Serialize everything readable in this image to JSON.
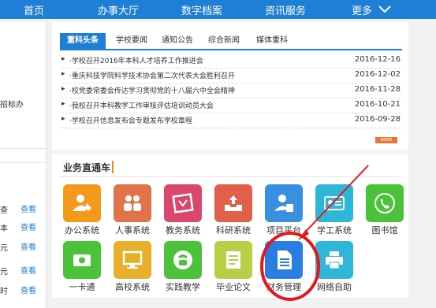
{
  "nav": {
    "items": [
      "首页",
      "办事大厅",
      "数字档案",
      "资讯服务",
      "更多"
    ]
  },
  "left": {
    "stub_text": "招标办",
    "rows": [
      {
        "prefix": "查",
        "link": "查看"
      },
      {
        "prefix": "本",
        "link": "查看"
      },
      {
        "prefix": "元",
        "link": "查看"
      },
      {
        "prefix": "元",
        "link": "查看"
      },
      {
        "prefix": "时",
        "link": "查看"
      }
    ]
  },
  "news": {
    "tabs": [
      "重科头条",
      "学校要闻",
      "通知公告",
      "综合新闻",
      "媒体重科"
    ],
    "items": [
      {
        "title": "·学校召开2016年本科人才培养工作推进会",
        "date": "2016-12-16"
      },
      {
        "title": "·重庆科技学院科学技术协会第二次代表大会胜利召开",
        "date": "2016-12-02"
      },
      {
        "title": "·校党委常委会传达学习贯彻党的十八届六中全会精神",
        "date": "2016-11-28"
      },
      {
        "title": "·我校召开本科教学工作审核评估培训动员大会",
        "date": "2016-10-21"
      },
      {
        "title": "·学校召开信息发布会专题发布学校章程",
        "date": "2016-09-28"
      }
    ],
    "more_label": "MORE"
  },
  "business": {
    "title": "业务直通车",
    "apps": [
      {
        "label": "办公系统",
        "color": "#f39a1d",
        "icon": "person-edit-icon"
      },
      {
        "label": "人事系统",
        "color": "#e0734a",
        "icon": "people-icon"
      },
      {
        "label": "教务系统",
        "color": "#d9476d",
        "icon": "certificate-icon"
      },
      {
        "label": "科研系统",
        "color": "#e0604a",
        "icon": "tray-upload-icon"
      },
      {
        "label": "项目平台",
        "color": "#3b8fe0",
        "icon": "person-doc-icon"
      },
      {
        "label": "学工系统",
        "color": "#2fb6d8",
        "icon": "id-card-icon"
      },
      {
        "label": "图书馆",
        "color": "#4cc23a",
        "icon": "phone-icon"
      },
      {
        "label": "一卡通",
        "color": "#4cc23a",
        "icon": "card-icon"
      },
      {
        "label": "高校系统",
        "color": "#e8b02a",
        "icon": "monitor-icon"
      },
      {
        "label": "实践教学",
        "color": "#4cc23a",
        "icon": "phone-ring-icon"
      },
      {
        "label": "毕业论文",
        "color": "#b6cf46",
        "icon": "note-icon"
      },
      {
        "label": "财务管理",
        "color": "#2b7de0",
        "icon": "document-icon"
      },
      {
        "label": "网络自助",
        "color": "#2fb6d8",
        "icon": "printer-icon"
      }
    ]
  },
  "annotation": {
    "color": "#e3181f"
  }
}
